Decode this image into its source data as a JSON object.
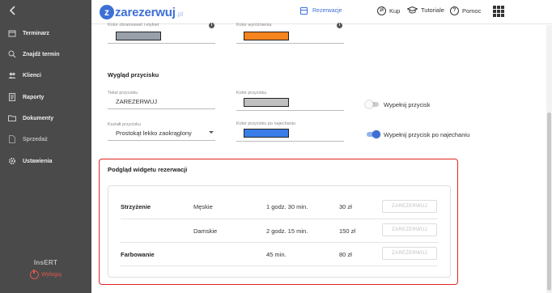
{
  "sidebar": {
    "items": [
      {
        "label": "Terminarz",
        "icon": "calendar-icon"
      },
      {
        "label": "Znajdź termin",
        "icon": "search-icon"
      },
      {
        "label": "Klienci",
        "icon": "people-icon"
      },
      {
        "label": "Raporty",
        "icon": "report-icon"
      },
      {
        "label": "Dokumenty",
        "icon": "folder-icon"
      },
      {
        "label": "Sprzedaż",
        "icon": "document-icon"
      },
      {
        "label": "Ustawienia",
        "icon": "gear-icon"
      }
    ],
    "brand": "InsERT",
    "logout": "Wyloguj"
  },
  "topbar": {
    "logo_main": "zarezerwuj",
    "logo_suffix": ".pl",
    "logo_z": "z",
    "reservations": "Rezerwacje",
    "buy": "Kup",
    "buy_icon_text": "zł",
    "tutorials": "Tutoriale",
    "help": "Pomoc",
    "help_icon_text": "?"
  },
  "colors_section": {
    "frame_label": "Kolor obramowań i etykiet",
    "frame_color": "#9aa0aa",
    "highlight_label": "Kolor wyróżnienia",
    "highlight_color": "#f5841f"
  },
  "button_section": {
    "title": "Wygląd przycisku",
    "text_label": "Tekst przycisku",
    "text_value": "ZAREZERWUJ",
    "button_color_label": "Kolor przycisku",
    "button_color": "#c0c0c0",
    "fill_button_label": "Wypełnij przycisk",
    "fill_button_on": false,
    "shape_label": "Kształt przycisku",
    "shape_value": "Prostokąt lekko zaokrąglony",
    "hover_color_label": "Kolor przycisku po najechaniu",
    "hover_color": "#3a7de8",
    "fill_hover_label": "Wypełnij przycisk po najechaniu",
    "fill_hover_on": true
  },
  "preview": {
    "title": "Podgląd widgetu rezerwacji",
    "rows": [
      {
        "service": "Strzyżenie",
        "variant": "Męskie",
        "duration": "1 godz. 30 min.",
        "price": "30 zł",
        "button": "ZAREZERWUJ"
      },
      {
        "service": "",
        "variant": "Damskie",
        "duration": "2 godz. 15 min.",
        "price": "150 zł",
        "button": "ZAREZERWUJ"
      },
      {
        "service": "Farbowanie",
        "variant": "",
        "duration": "45 min.",
        "price": "80 zł",
        "button": "ZAREZERWUJ"
      }
    ]
  }
}
